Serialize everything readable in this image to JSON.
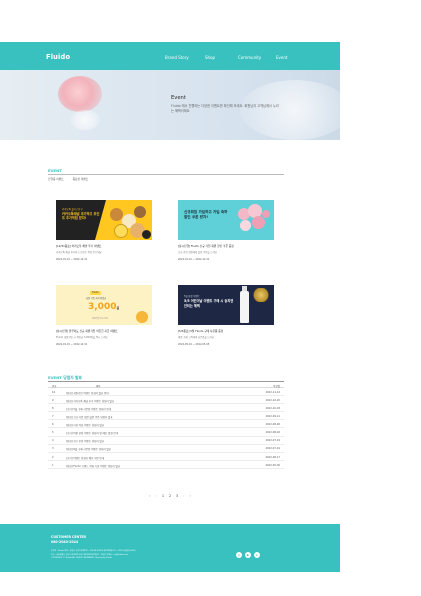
{
  "header": {
    "logo": "Fluido",
    "nav": [
      "Brand Story",
      "Shop",
      "Community",
      "Event"
    ]
  },
  "hero": {
    "title": "Event",
    "subtitle": "Fluido 에서 진행하는 다양한 이벤트를 확인해 보세요. 회원님의 고객님께서 누리는 혜택이에요"
  },
  "events_section": {
    "title": "EVENT",
    "tabs": [
      "진행중 이벤트",
      "종료된 이벤트"
    ]
  },
  "cards": [
    {
      "banner_small": "카카오톡 플러스친구",
      "banner_main": "카카오톡채널 추가하고 포인트 추가적립 받자!",
      "title": "[12/31종료] 카카오톡 채널 추가 이벤트",
      "desc": "카카오톡 채널 추가하고 포인트 적립 받으세요",
      "date": "2022-01-01 ~ 2022-12-31"
    },
    {
      "banner_main": "신규회원 가입하고 가입 축하 할인 쿠폰 받자!",
      "title": "[상시진행] Fluido 신규 가입 회원 할인 쿠폰 증정",
      "desc": "신규 가입 회원에게 할인 쿠폰을 드려요",
      "date": "2022-01-01 ~ 2022-12-31"
    },
    {
      "banner_tag": "Fluido",
      "banner_small": "회원 가입 축하 적립금",
      "banner_amount": "3,000",
      "banner_unit": "원",
      "banner_note": "회원가입 즉시 지급",
      "title": "[상시진행] 플루이도 신규 회원가입 적립금 지급 이벤트",
      "desc": "Fluido 회원가입 시 적립금 3,000원을 즉시 드려요",
      "date": "2022-01-01 ~ 2022-12-31"
    },
    {
      "banner_small": "5월 한정 이벤트",
      "banner_main": "5/5 어린이날 이벤트 구매 시 놓치면 안되는 혜택",
      "title": "[5/5종료] 5월 Fluido 구매 사은품 증정",
      "desc": "제품 구매 고객에게 사은품을 드려요",
      "date": "2022-05-01 ~ 2022-05-05"
    }
  ],
  "winners": {
    "title": "EVENT 당첨자 발표",
    "columns": [
      "번호",
      "제목",
      "작성일"
    ],
    "rows": [
      {
        "no": "10",
        "title": "[당첨] 회원가입 이벤트 당첨자 발표 안내",
        "date": "2022-11-14"
      },
      {
        "no": "9",
        "title": "[당첨] 카카오톡 채널 추가 이벤트 당첨자 발표",
        "date": "2022-10-20"
      },
      {
        "no": "8",
        "title": "[공지] 5월 구매 사은품 이벤트 당첨자 안내",
        "date": "2022-10-03"
      },
      {
        "no": "7",
        "title": "[당첨] 신규 가입 회원 할인 쿠폰 당첨자 발표",
        "date": "2022-09-11"
      },
      {
        "no": "6",
        "title": "[당첨] 리뷰 작성 이벤트 당첨자 발표",
        "date": "2022-08-26"
      },
      {
        "no": "5",
        "title": "[공지] 여름 한정 이벤트 당첨자 및 배송 일정 안내",
        "date": "2022-08-02"
      },
      {
        "no": "4",
        "title": "[당첨] 친구 추천 이벤트 당첨자 발표",
        "date": "2022-07-19"
      },
      {
        "no": "3",
        "title": "[당첨] 6월 구매 사은품 이벤트 당첨자 발표",
        "date": "2022-07-01"
      },
      {
        "no": "2",
        "title": "[공지] 이벤트 당첨자 배송 지연 안내",
        "date": "2022-06-17"
      },
      {
        "no": "1",
        "title": "[당첨] Fluido 브랜드 런칭 기념 이벤트 당첨자 발표",
        "date": "2022-05-30"
      }
    ]
  },
  "pager": {
    "first": "«",
    "prev": "‹",
    "pages": [
      "1",
      "2",
      "3"
    ],
    "next": "›",
    "last": "»"
  },
  "footer": {
    "line1": "CUSTOMER CENTER",
    "line2": "080-2040-2044",
    "line3": "상호명 : Fluido   대표 : 홍길동   사업자등록번호 : 123-45-67890   통신판매업신고 : 2022-서울강남-0000",
    "line4": "주소 : 서울특별시 강남구 테헤란로 000   개인정보관리책임자 : 홍길동   이메일 : cs@fluido.co.kr",
    "line5": "COPYRIGHT (C) Fluido ALL RIGHTS RESERVED.   Hosting by Fluido",
    "sns": [
      "instagram-icon",
      "youtube-icon",
      "blog-icon"
    ]
  },
  "colors": {
    "brand": "#38c1bf"
  }
}
